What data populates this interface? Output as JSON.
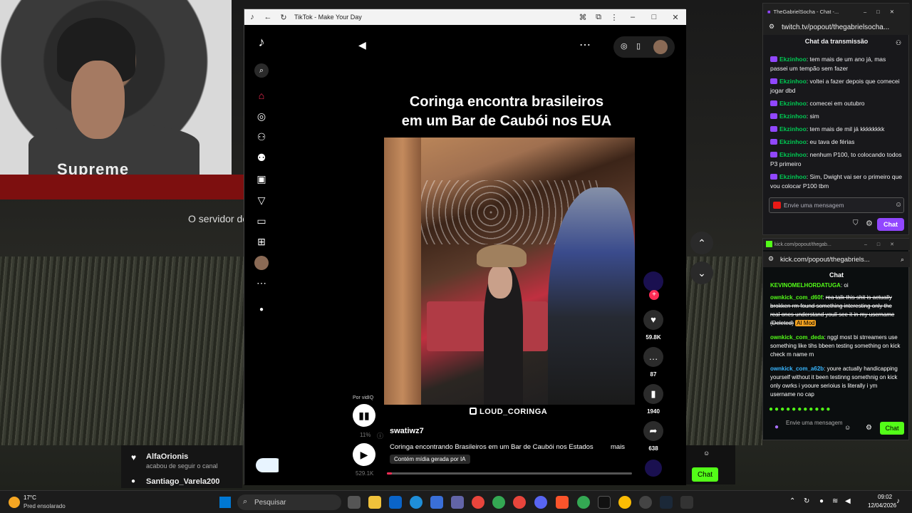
{
  "background": {
    "cam_shirt_text": "Supreme",
    "server_text": "O servidor de",
    "events": [
      {
        "name": "AlfaOrionis",
        "sub": "acabou de seguir o canal"
      },
      {
        "name": "Santiago_Varela200",
        "sub": ""
      }
    ],
    "kick_chat_btn": "Chat"
  },
  "tiktok": {
    "window_title": "TikTok - Make Your Day",
    "video_title_line1": "Coringa encontra brasileiros",
    "video_title_line2": "em um Bar de Caubói nos EUA",
    "watermark": "LOUD_CORINGA",
    "por_vidiq": "Por vidIQ",
    "vidiq_percent": "11%",
    "views": "529.1K",
    "author": "swatiwz7",
    "description": "Coringa encontrando Brasileiros em um Bar de Caubói nos Estados",
    "more": "mais",
    "ai_label": "Contém mídia gerada por IA",
    "progress": 0.02,
    "actions": {
      "likes": "59.8K",
      "comments": "87",
      "saves": "1940",
      "shares": "638"
    }
  },
  "twitch": {
    "window_title": "TheGabrielSocha - Chat -...",
    "url": "twitch.tv/popout/thegabrielsocha...",
    "header": "Chat da transmissão",
    "messages": [
      {
        "user": "Ekzinhoo",
        "text": "tem mais de um ano já, mas passei um tempão sem fazer"
      },
      {
        "user": "Ekzinhoo",
        "text": "voltei a fazer depois que comecei jogar dbd"
      },
      {
        "user": "Ekzinhoo",
        "text": "comecei em outubro"
      },
      {
        "user": "Ekzinhoo",
        "text": "sim"
      },
      {
        "user": "Ekzinhoo",
        "text": "tem mais de mil já kkkkkkkk"
      },
      {
        "user": "Ekzinhoo",
        "text": "eu tava de férias"
      },
      {
        "user": "Ekzinhoo",
        "text": "nenhum P100, to colocando todos P3 primeiro"
      },
      {
        "user": "Ekzinhoo",
        "text": "Sim, Dwight vai ser o primeiro que vou colocar P100 tbm"
      }
    ],
    "input_placeholder": "Envie uma mensagem",
    "chat_btn": "Chat"
  },
  "kick": {
    "window_title": "kick.com/popout/thegab...",
    "url": "kick.com/popout/thegabriels...",
    "header": "Chat",
    "messages": [
      {
        "user": "KEVINOMELHORDATUGA",
        "text": "oi",
        "style": "green"
      },
      {
        "user": "ownkick_com_d60f",
        "text": "rea talk this shit is actually brokken rm found something interesting only the real ones understand youll see it in my username (Deleted)",
        "style": "deleted",
        "badge": "AI Mod"
      },
      {
        "user": "ownkick_com_deda",
        "text": "nggl most bi strreamers use something like tihs bbeen testing something on kick check m name rn",
        "style": "green"
      },
      {
        "user": "ownkick_com_a62b",
        "text": "youre actually handicapping yourself without it been testinng somethnig on kick only owrks i yooure serioius is literally i ym username no cap",
        "style": "blue"
      }
    ],
    "input_placeholder": "Envie uma mensagem",
    "chat_btn": "Chat"
  },
  "taskbar": {
    "temp": "17°C",
    "weather": "Pred ensolarado",
    "search_placeholder": "Pesquisar",
    "time": "09:02",
    "date": "12/04/2026"
  }
}
